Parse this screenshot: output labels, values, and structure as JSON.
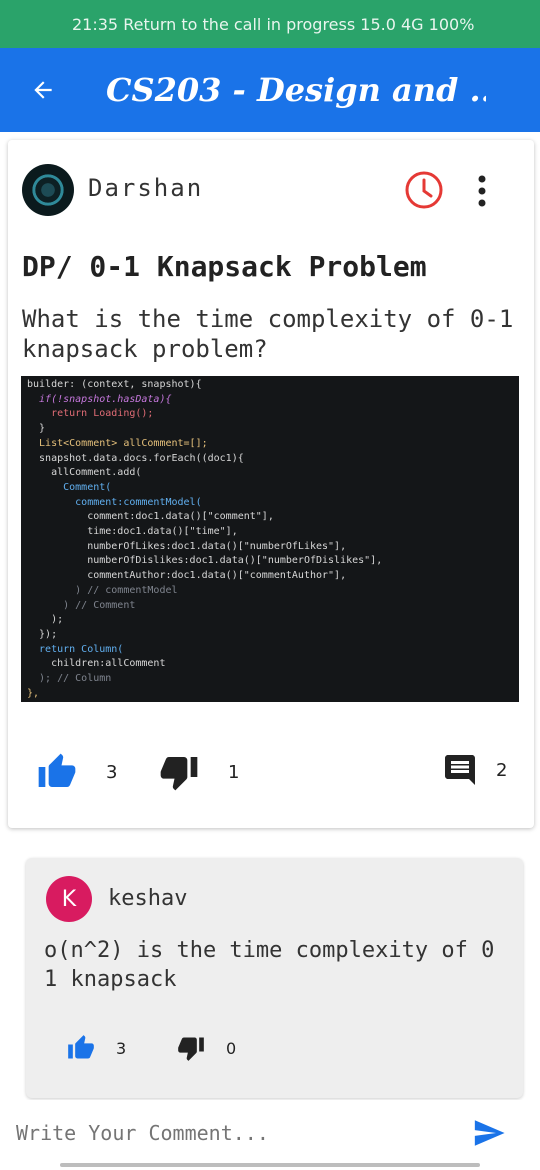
{
  "status_bar": {
    "text": "21:35  Return to the call in progress  15.0  4G  100%"
  },
  "app_bar": {
    "back_icon": "arrow-back-icon",
    "title": "CS203 - Design and ..."
  },
  "post": {
    "author": "Darshan",
    "title": "DP/ 0-1 Knapsack Problem",
    "body": "What is the time complexity of 0-1 knapsack problem?",
    "code_lines": [
      "builder: (context, snapshot){",
      "  if(!snapshot.hasData){",
      "    return Loading();",
      "  }",
      "  List<Comment> allComment=[];",
      "  snapshot.data.docs.forEach((doc1){",
      "    allComment.add(",
      "      Comment(",
      "        comment:commentModel(",
      "          comment:doc1.data()[\"comment\"],",
      "          time:doc1.data()[\"time\"],",
      "          numberOfLikes:doc1.data()[\"numberOfLikes\"],",
      "          numberOfDislikes:doc1.data()[\"numberOfDislikes\"],",
      "          commentAuthor:doc1.data()[\"commentAuthor\"],",
      "        ) // commentModel",
      "      ) // Comment",
      "    );",
      "  });",
      "  return Column(",
      "    children:allComment",
      "  ); // Column",
      "},"
    ],
    "likes": "3",
    "dislikes": "1",
    "comments": "2"
  },
  "comment": {
    "avatar_letter": "K",
    "author": "keshav",
    "text": "o(n^2) is the time complexity of 0 1 knapsack",
    "likes": "3",
    "dislikes": "0"
  },
  "input": {
    "placeholder": "Write Your Comment..."
  },
  "colors": {
    "status_bar": "#2aa36a",
    "app_bar": "#1a73e8",
    "clock": "#e53935",
    "like": "#1a73e8",
    "avatar_k": "#d81b60"
  }
}
